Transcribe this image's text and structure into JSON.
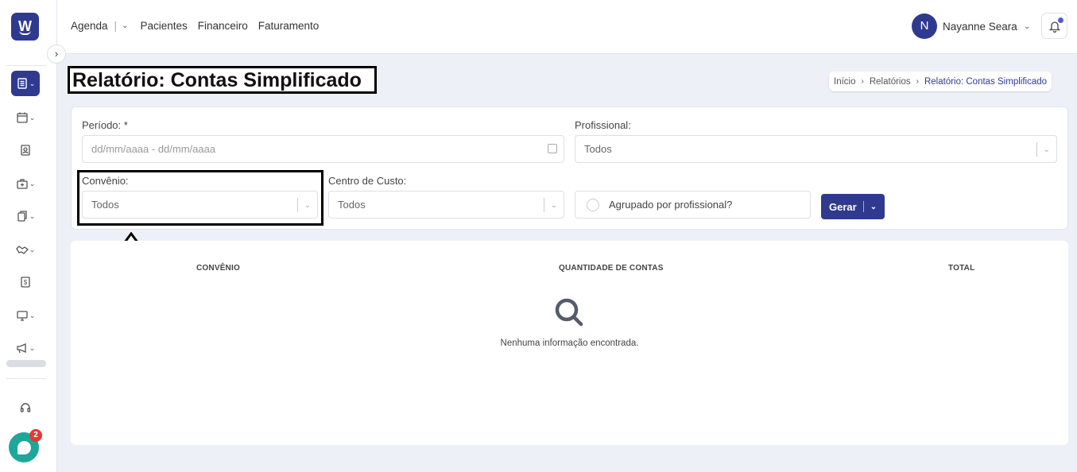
{
  "brand": {
    "logo_letter": "W"
  },
  "sidebar": {
    "items": [
      {
        "icon": "report-icon",
        "active": true
      },
      {
        "icon": "calendar-icon"
      },
      {
        "icon": "contact-card-icon"
      },
      {
        "icon": "medical-case-icon"
      },
      {
        "icon": "documents-icon"
      },
      {
        "icon": "handshake-icon"
      },
      {
        "icon": "billing-icon"
      },
      {
        "icon": "monitor-icon"
      },
      {
        "icon": "megaphone-icon"
      }
    ],
    "support_icon": "headset-icon",
    "chat_badge": "2"
  },
  "topnav": {
    "agenda": "Agenda",
    "pacientes": "Pacientes",
    "financeiro": "Financeiro",
    "faturamento": "Faturamento"
  },
  "user": {
    "initial": "N",
    "name": "Nayanne Seara"
  },
  "page": {
    "title": "Relatório: Contas Simplificado"
  },
  "breadcrumb": {
    "home": "Início",
    "section": "Relatórios",
    "current": "Relatório: Contas Simplificado"
  },
  "filters": {
    "periodo_label": "Período: *",
    "periodo_placeholder": "dd/mm/aaaa - dd/mm/aaaa",
    "profissional_label": "Profissional:",
    "profissional_value": "Todos",
    "convenio_label": "Convênio:",
    "convenio_value": "Todos",
    "centro_label": "Centro de Custo:",
    "centro_value": "Todos",
    "agrupado_label": "Agrupado por profissional?",
    "gerar_label": "Gerar"
  },
  "table": {
    "col_convenio": "CONVÊNIO",
    "col_quantidade": "QUANTIDADE DE CONTAS",
    "col_total": "TOTAL",
    "empty_message": "Nenhuma informação encontrada."
  },
  "colors": {
    "primary": "#2f3a8f",
    "chat": "#1ea69a",
    "badge": "#e53935",
    "background": "#eef0f8"
  }
}
